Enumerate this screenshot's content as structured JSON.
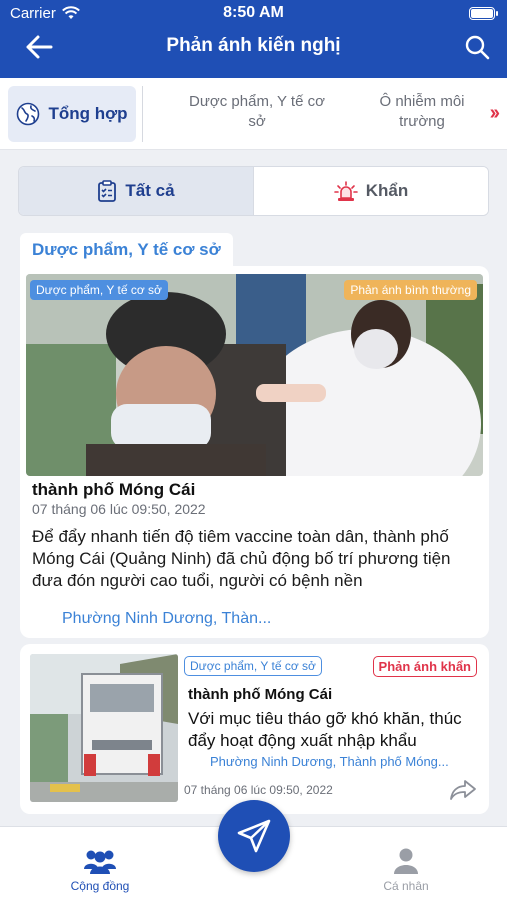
{
  "status_bar": {
    "carrier": "Carrier",
    "time": "8:50 AM"
  },
  "header": {
    "title": "Phản ánh kiến nghị"
  },
  "categories": [
    {
      "label": "Tổng hợp",
      "active": true
    },
    {
      "label": "Dược phẩm, Y tế cơ sở",
      "active": false
    },
    {
      "label": "Ô nhiễm môi trường",
      "active": false
    }
  ],
  "filters": {
    "all_label": "Tất cả",
    "urgent_label": "Khẩn"
  },
  "section": {
    "label": "Dược phẩm, Y tế cơ sở"
  },
  "posts": [
    {
      "category": "Dược phẩm, Y tế cơ sở",
      "status": "Phản ánh bình thường",
      "title": "thành phố Móng Cái",
      "time": "07 tháng 06 lúc 09:50, 2022",
      "body": "Để đẩy nhanh tiến độ tiêm vaccine toàn dân, thành phố Móng Cái (Quảng Ninh) đã chủ động bố trí phương tiện đưa đón người cao tuổi, người có bệnh nền",
      "location": "Phường Ninh Dương, Thàn..."
    },
    {
      "category": "Dược phẩm, Y tế cơ sở",
      "status": "Phản ánh khẩn",
      "title": "thành phố Móng Cái",
      "body": "Với mục tiêu tháo gỡ khó khăn, thúc đẩy hoạt động xuất nhập khẩu",
      "location": "Phường Ninh Dương, Thành phố Móng...",
      "time": "07 tháng 06 lúc 09:50, 2022"
    }
  ],
  "bottom_nav": {
    "community_label": "Cộng đồng",
    "profile_label": "Cá nhân"
  },
  "colors": {
    "primary": "#1f4fb5",
    "link": "#3b82d6",
    "urgent": "#e0344a",
    "normal_badge": "#efb45a"
  }
}
